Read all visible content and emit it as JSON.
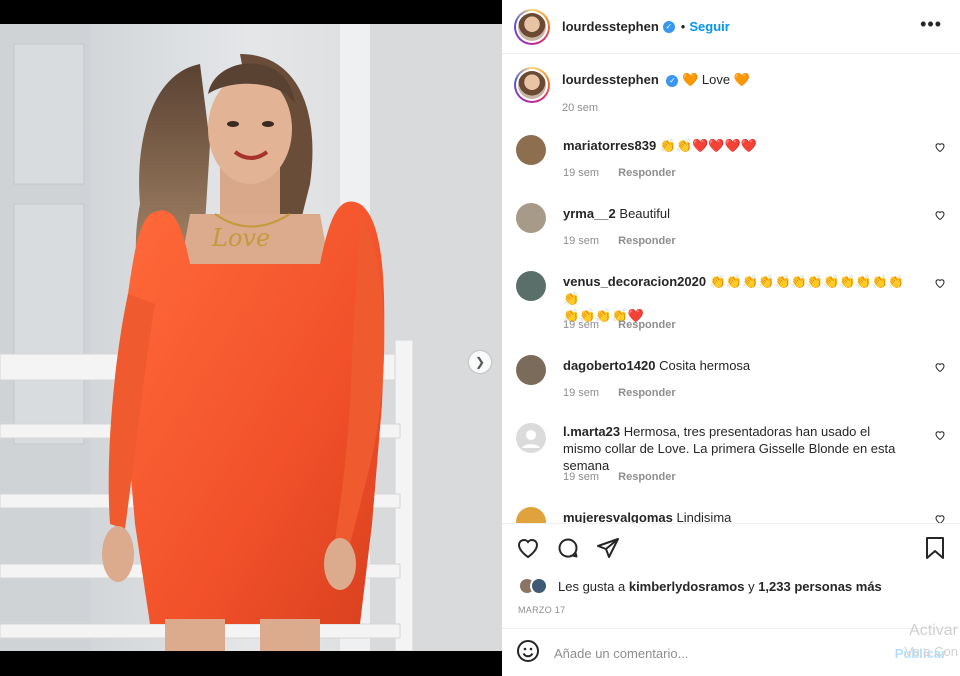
{
  "post": {
    "author": "lourdesstephen",
    "separator": "•",
    "follow_label": "Seguir",
    "more_icon": "more-horizontal-icon",
    "caption_text": "Love",
    "caption_time": "20 sem",
    "accent": "#0095f6",
    "dress_color": "#ff5a2e"
  },
  "comments": [
    {
      "user": "mariatorres839",
      "text": "👏👏❤️❤️❤️❤️",
      "time": "19 sem",
      "reply": "Responder",
      "avatar_color": "#8d6e4f"
    },
    {
      "user": "yrma__2",
      "text": "Beautiful",
      "time": "19 sem",
      "reply": "Responder",
      "avatar_color": "#a79a88"
    },
    {
      "user": "venus_decoracion2020",
      "text": "👏👏👏👏👏👏👏👏👏👏👏👏👏",
      "text2": "👏👏👏👏❤️",
      "time": "19 sem",
      "reply": "Responder",
      "avatar_color": "#5b6f6a"
    },
    {
      "user": "dagoberto1420",
      "text": "Cosita hermosa",
      "time": "19 sem",
      "reply": "Responder",
      "avatar_color": "#7a6b5a"
    },
    {
      "user": "l.marta23",
      "text": "Hermosa, tres presentadoras han usado el mismo collar de Love. La primera Gisselle Blonde en esta semana",
      "time": "19 sem",
      "reply": "Responder",
      "avatar_color": "#dbdbdb"
    },
    {
      "user": "mujeresvalgomas",
      "text": "Lindisima",
      "time": "",
      "reply": "",
      "avatar_color": "#e0a23a"
    }
  ],
  "actions": {
    "likes_prefix": "Les gusta a",
    "likes_user": "kimberlydosramos",
    "likes_and": "y",
    "likes_rest": "1,233 personas más",
    "date": "MARZO 17",
    "comment_placeholder": "Añade un comentario...",
    "publish_label": "Publicar"
  },
  "overlay": {
    "line1": "Activar",
    "line2": "Ve a Con"
  }
}
